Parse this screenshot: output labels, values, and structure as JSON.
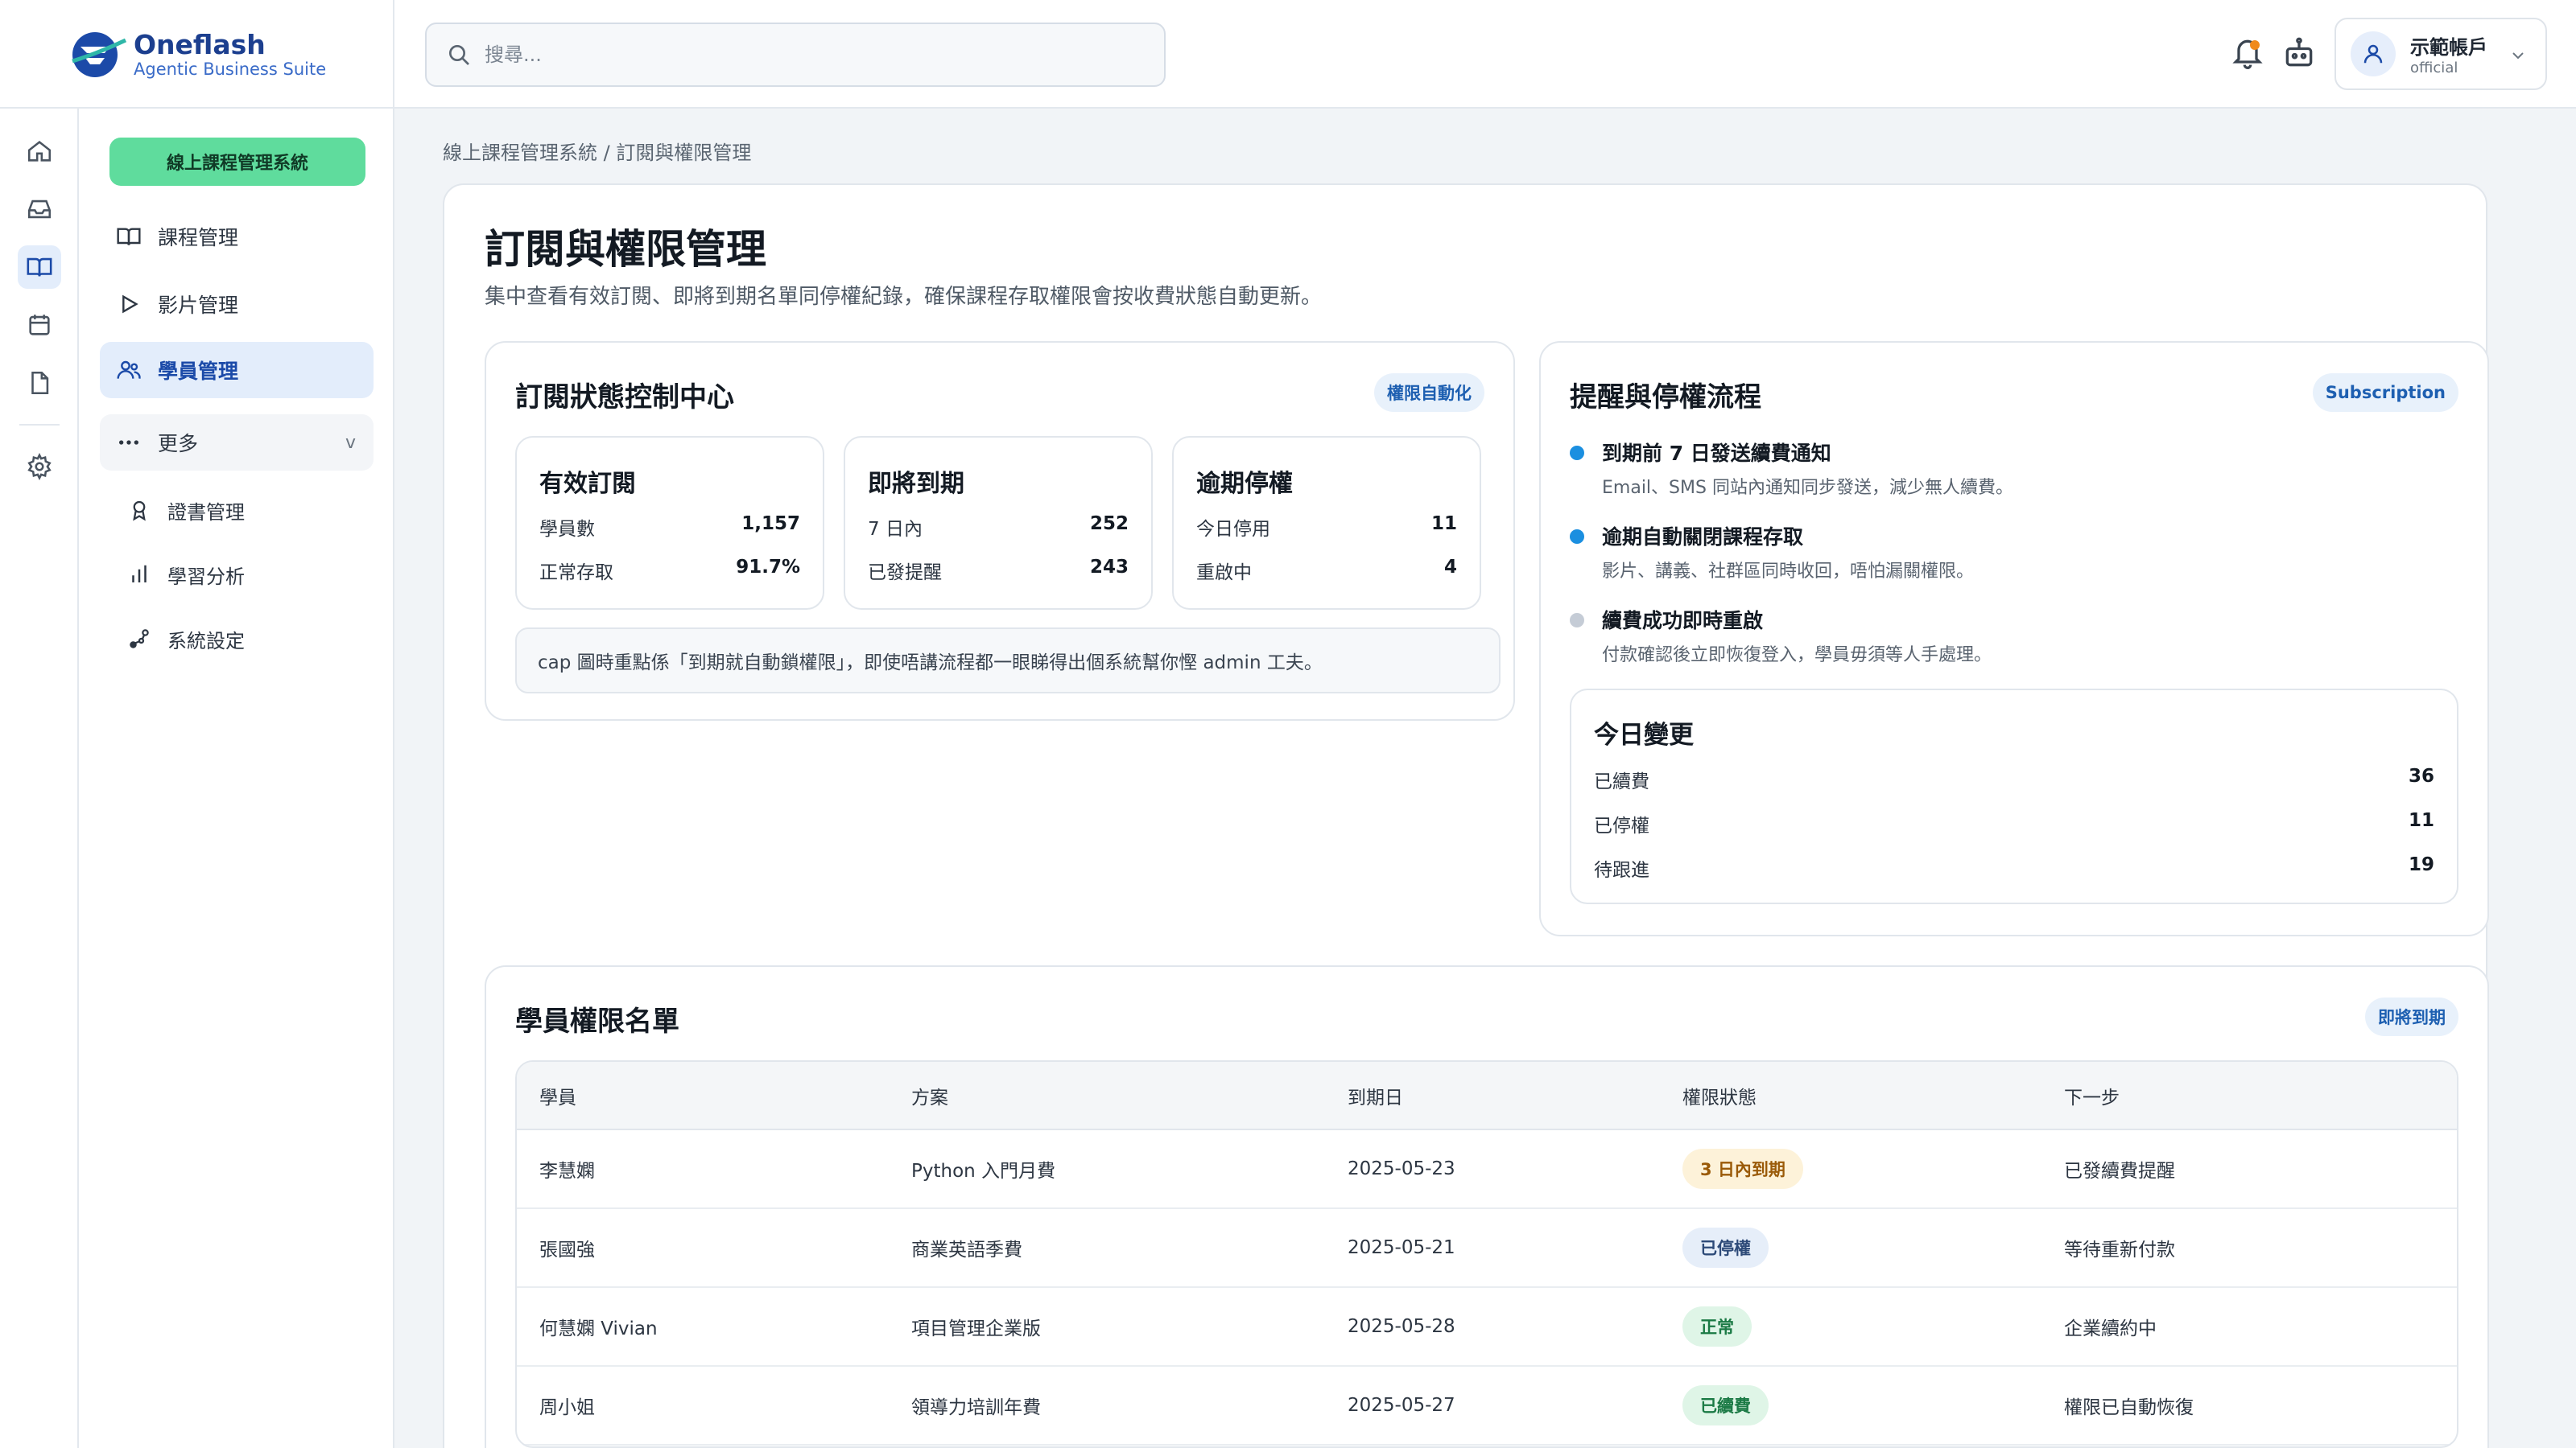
{
  "brand": {
    "name": "Oneflash",
    "tagline": "Agentic Business Suite"
  },
  "search": {
    "placeholder": "搜尋..."
  },
  "account": {
    "name": "示範帳戶",
    "role": "official"
  },
  "sidebar": {
    "system_button": "線上課程管理系統",
    "items": [
      {
        "label": "課程管理",
        "icon": "book-icon"
      },
      {
        "label": "影片管理",
        "icon": "play-icon"
      },
      {
        "label": "學員管理",
        "icon": "users-icon",
        "active": true
      }
    ],
    "more": {
      "label": "更多",
      "chevron": "v"
    },
    "sub_items": [
      {
        "label": "證書管理",
        "icon": "award-icon"
      },
      {
        "label": "學習分析",
        "icon": "bar-chart-icon"
      },
      {
        "label": "系統設定",
        "icon": "settings-link-icon"
      }
    ]
  },
  "breadcrumb": "線上課程管理系統 / 訂閱與權限管理",
  "page": {
    "title": "訂閱與權限管理",
    "description": "集中查看有效訂閱、即將到期名單同停權紀錄，確保課程存取權限會按收費狀態自動更新。"
  },
  "control_center": {
    "title": "訂閱狀態控制中心",
    "tag": "權限自動化",
    "stats": [
      {
        "title": "有效訂閱",
        "rows": [
          {
            "label": "學員數",
            "value": "1,157"
          },
          {
            "label": "正常存取",
            "value": "91.7%"
          }
        ]
      },
      {
        "title": "即將到期",
        "rows": [
          {
            "label": "7 日內",
            "value": "252"
          },
          {
            "label": "已發提醒",
            "value": "243"
          }
        ]
      },
      {
        "title": "逾期停權",
        "rows": [
          {
            "label": "今日停用",
            "value": "11"
          },
          {
            "label": "重啟中",
            "value": "4"
          }
        ]
      }
    ],
    "note": "cap 圖時重點係「到期就自動鎖權限」，即使唔講流程都一眼睇得出個系統幫你慳 admin 工夫。"
  },
  "flow": {
    "title": "提醒與停權流程",
    "tag": "Subscription",
    "steps": [
      {
        "title": "到期前 7 日發送續費通知",
        "desc": "Email、SMS 同站內通知同步發送，減少無人續費。",
        "color": "#1b8fe0"
      },
      {
        "title": "逾期自動關閉課程存取",
        "desc": "影片、講義、社群區同時收回，唔怕漏關權限。",
        "color": "#1b8fe0"
      },
      {
        "title": "續費成功即時重啟",
        "desc": "付款確認後立即恢復登入，學員毋須等人手處理。",
        "color": "#c5ccd6"
      }
    ],
    "today": {
      "title": "今日變更",
      "rows": [
        {
          "label": "已續費",
          "value": "36"
        },
        {
          "label": "已停權",
          "value": "11"
        },
        {
          "label": "待跟進",
          "value": "19"
        }
      ]
    }
  },
  "roster": {
    "title": "學員權限名單",
    "tag": "即將到期",
    "columns": [
      "學員",
      "方案",
      "到期日",
      "權限狀態",
      "下一步"
    ],
    "rows": [
      {
        "student": "李慧嫻",
        "plan": "Python 入門月費",
        "expiry": "2025-05-23",
        "status": "3 日內到期",
        "next": "已發續費提醒"
      },
      {
        "student": "張國強",
        "plan": "商業英語季費",
        "expiry": "2025-05-21",
        "status": "已停權",
        "next": "等待重新付款"
      },
      {
        "student": "何慧嫻 Vivian",
        "plan": "項目管理企業版",
        "expiry": "2025-05-28",
        "status": "正常",
        "next": "企業續約中"
      },
      {
        "student": "周小姐",
        "plan": "領導力培訓年費",
        "expiry": "2025-05-27",
        "status": "已續費",
        "next": "權限已自動恢復"
      }
    ]
  },
  "rail_icons": [
    "home-icon",
    "inbox-icon",
    "book-open-icon",
    "calendar-icon",
    "file-icon",
    "gear-icon"
  ],
  "colors": {
    "accent": "#1b4aa8",
    "system_button": "#5fdc9d",
    "warning": "#9a5a08",
    "success": "#1b7a45"
  }
}
